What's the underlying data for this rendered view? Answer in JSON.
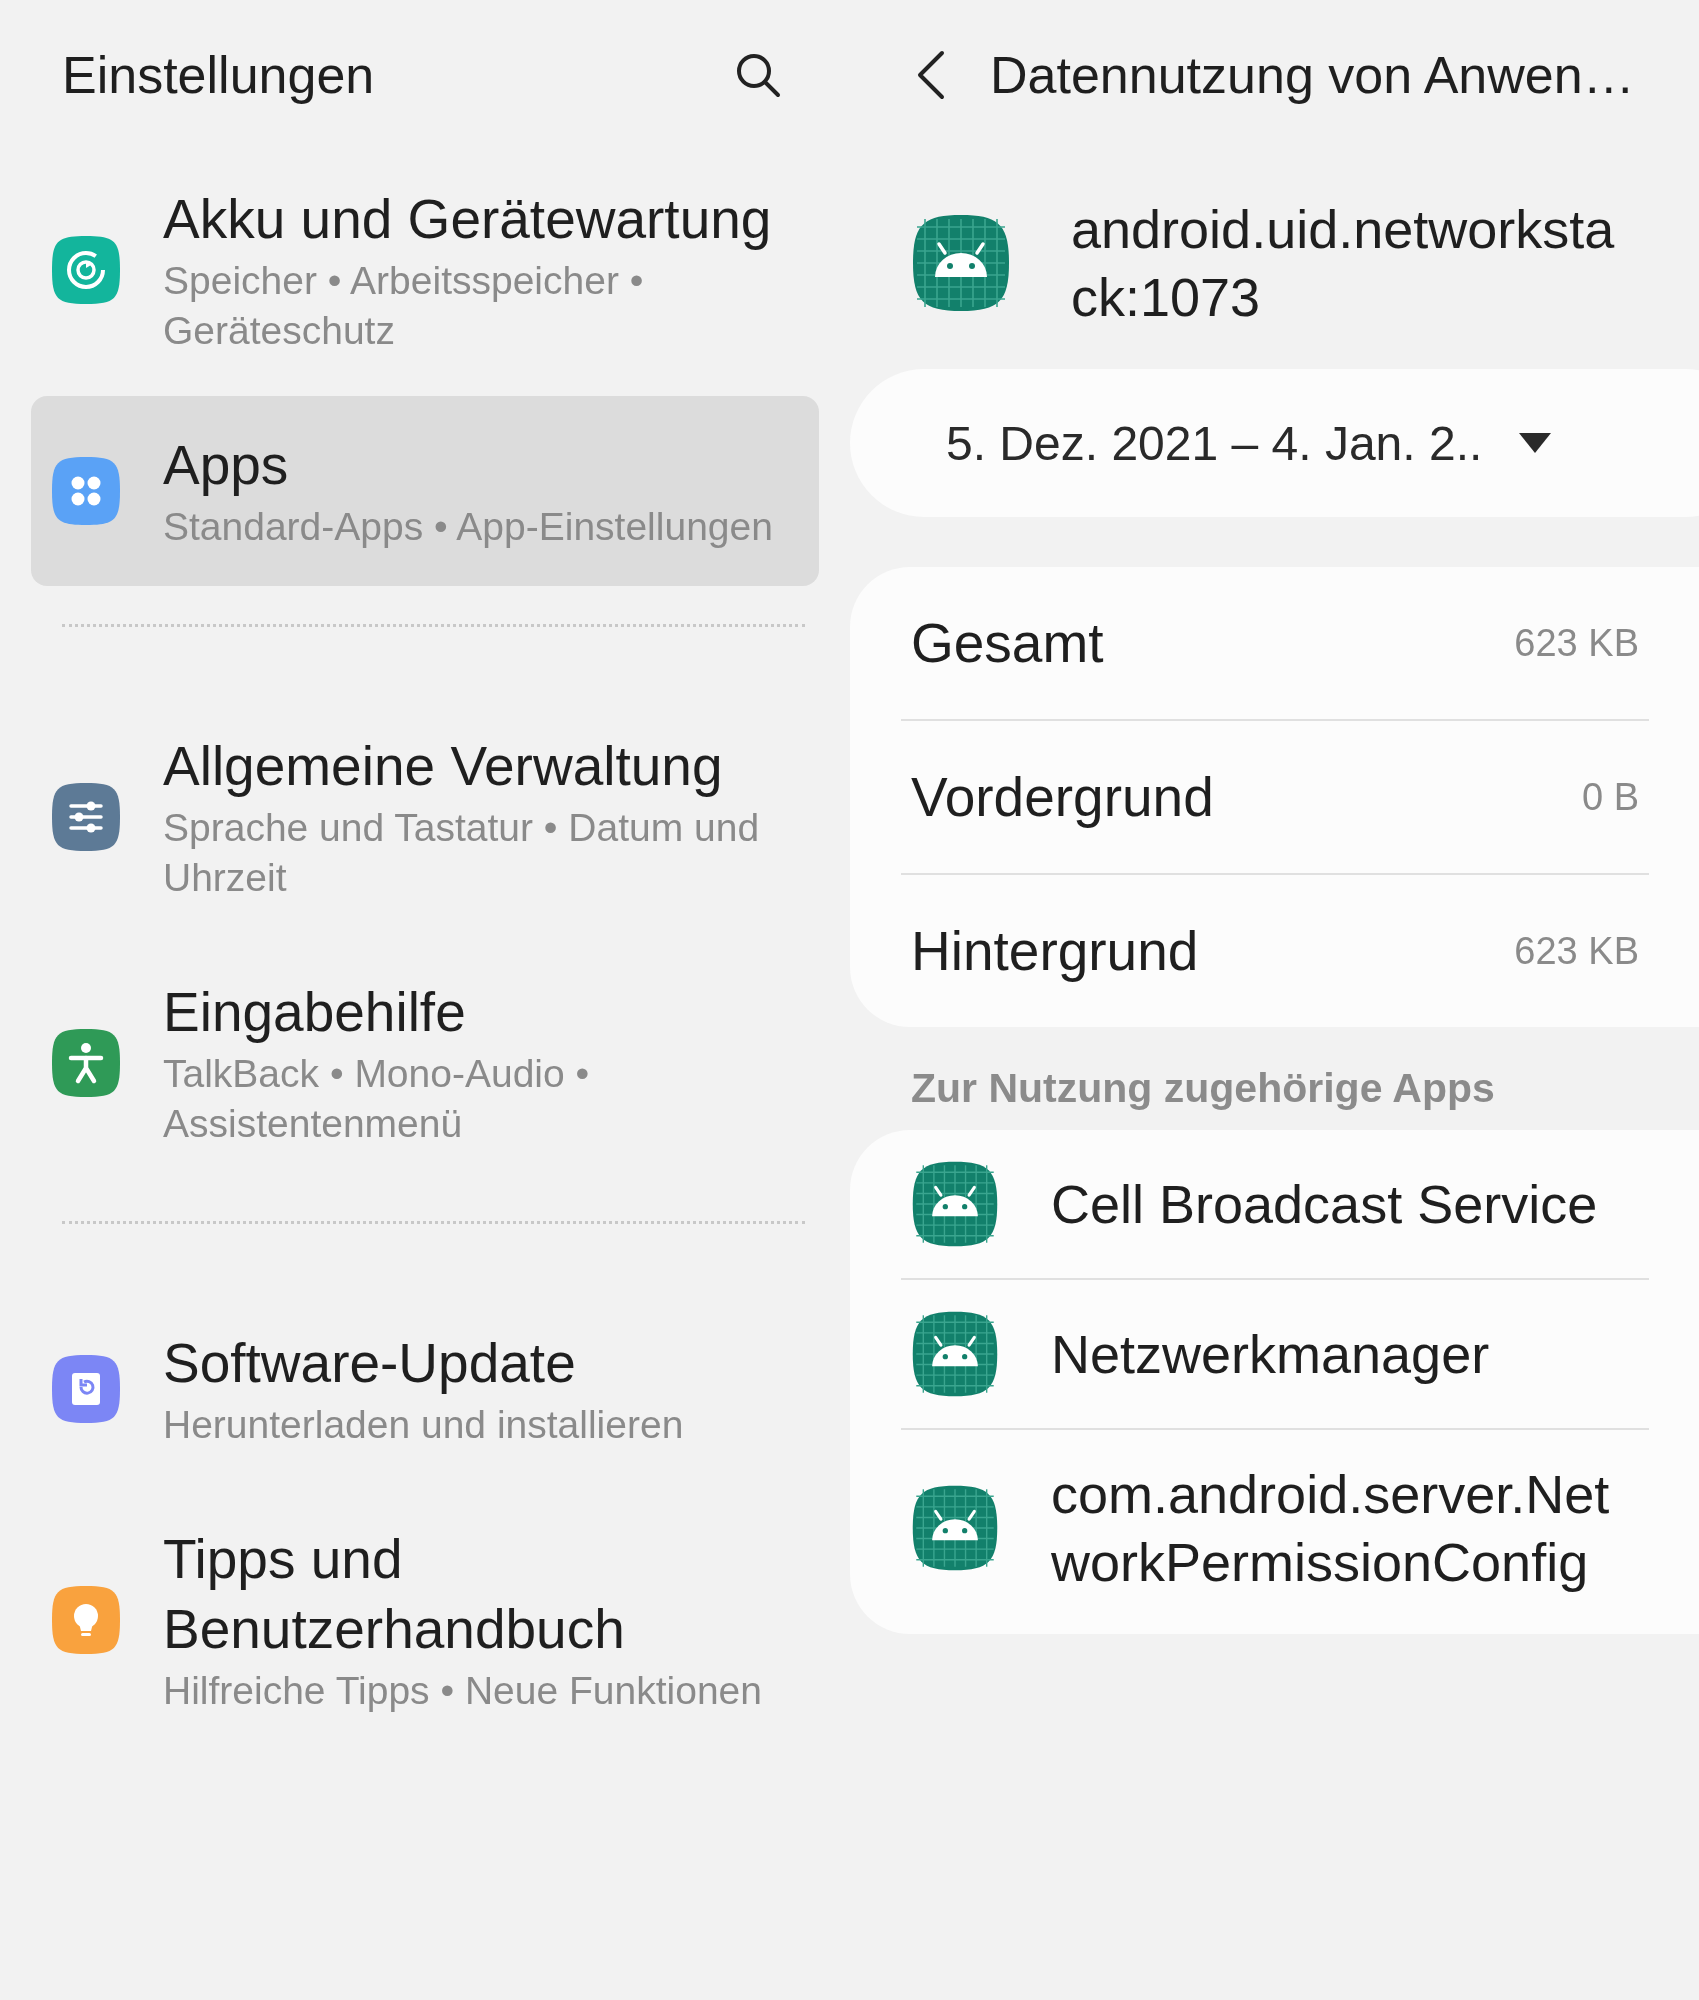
{
  "settings": {
    "title": "Einstellungen",
    "groups": [
      {
        "items": [
          {
            "title": "Akku und Gerätewartung",
            "subtitle": "Speicher • Arbeitsspeicher • Geräteschutz",
            "selected": false
          },
          {
            "title": "Apps",
            "subtitle": "Standard-Apps • App-Einstellungen",
            "selected": true
          }
        ]
      },
      {
        "items": [
          {
            "title": "Allgemeine Verwaltung",
            "subtitle": "Sprache und Tastatur • Datum und Uhrzeit",
            "selected": false
          },
          {
            "title": "Eingabehilfe",
            "subtitle": "TalkBack • Mono-Audio • Assistentenmenü",
            "selected": false
          }
        ]
      },
      {
        "items": [
          {
            "title": "Software-Update",
            "subtitle": "Herunterladen und installieren",
            "selected": false
          },
          {
            "title": "Tipps und Benutzerhandbuch",
            "subtitle": "Hilfreiche Tipps • Neue Funktionen",
            "selected": false
          }
        ]
      }
    ]
  },
  "detail": {
    "title": "Datennutzung von Anwen…",
    "app_name": "android.uid.networkstack:1073",
    "date_range": "5. Dez. 2021 – 4. Jan. 2..",
    "usage": [
      {
        "label": "Gesamt",
        "value": "623 KB"
      },
      {
        "label": "Vordergrund",
        "value": "0 B"
      },
      {
        "label": "Hintergrund",
        "value": "623 KB"
      }
    ],
    "related_title": "Zur Nutzung zugehörige Apps",
    "related_apps": [
      {
        "name": "Cell Broadcast Service"
      },
      {
        "name": "Netzwerkmanager"
      },
      {
        "name": "com.android.server.NetworkPermissionConfig"
      }
    ]
  }
}
